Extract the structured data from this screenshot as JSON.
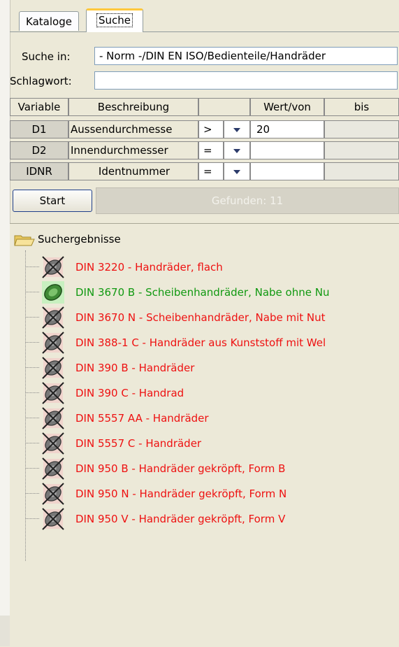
{
  "tabs": [
    {
      "label": "Kataloge",
      "active": false
    },
    {
      "label": "Suche",
      "active": true
    }
  ],
  "search": {
    "suche_in_label": "Suche in:",
    "suche_in_value": "- Norm -/DIN EN ISO/Bedienteile/Handräder",
    "schlagwort_label": "Schlagwort:",
    "schlagwort_value": ""
  },
  "grid": {
    "headers": [
      "Variable",
      "Beschreibung",
      "",
      "Wert/von",
      "bis"
    ],
    "rows": [
      {
        "variable": "D1",
        "beschreibung": "Aussendurchmesse",
        "op": ">",
        "von": "20",
        "bis": ""
      },
      {
        "variable": "D2",
        "beschreibung": "Innendurchmesser",
        "op": "=",
        "von": "",
        "bis": ""
      },
      {
        "variable": "IDNR",
        "beschreibung": "Identnummer",
        "op": "=",
        "von": "",
        "bis": ""
      }
    ]
  },
  "start_label": "Start",
  "found_label": "Gefunden: 11",
  "tree": {
    "root": "Suchergebnisse",
    "items": [
      {
        "label": "DIN 3220 - Handräder, flach",
        "status": "red"
      },
      {
        "label": "DIN 3670 B - Scheibenhandräder, Nabe ohne Nu",
        "status": "green"
      },
      {
        "label": "DIN 3670 N - Scheibenhandräder, Nabe mit Nut",
        "status": "red"
      },
      {
        "label": "DIN 388-1 C - Handräder aus Kunststoff mit Wel",
        "status": "red"
      },
      {
        "label": "DIN 390 B - Handräder",
        "status": "red"
      },
      {
        "label": "DIN 390 C - Handrad",
        "status": "red"
      },
      {
        "label": "DIN 5557 AA - Handräder",
        "status": "red"
      },
      {
        "label": "DIN 5557 C - Handräder",
        "status": "red"
      },
      {
        "label": "DIN 950 B - Handräder gekröpft, Form B",
        "status": "red"
      },
      {
        "label": "DIN 950 N - Handräder gekröpft, Form N",
        "status": "red"
      },
      {
        "label": "DIN 950 V - Handräder gekröpft, Form V",
        "status": "red"
      }
    ]
  },
  "colors": {
    "unavailable": "#ee1111",
    "available": "#119911",
    "active_tab": "#ffc83c"
  }
}
